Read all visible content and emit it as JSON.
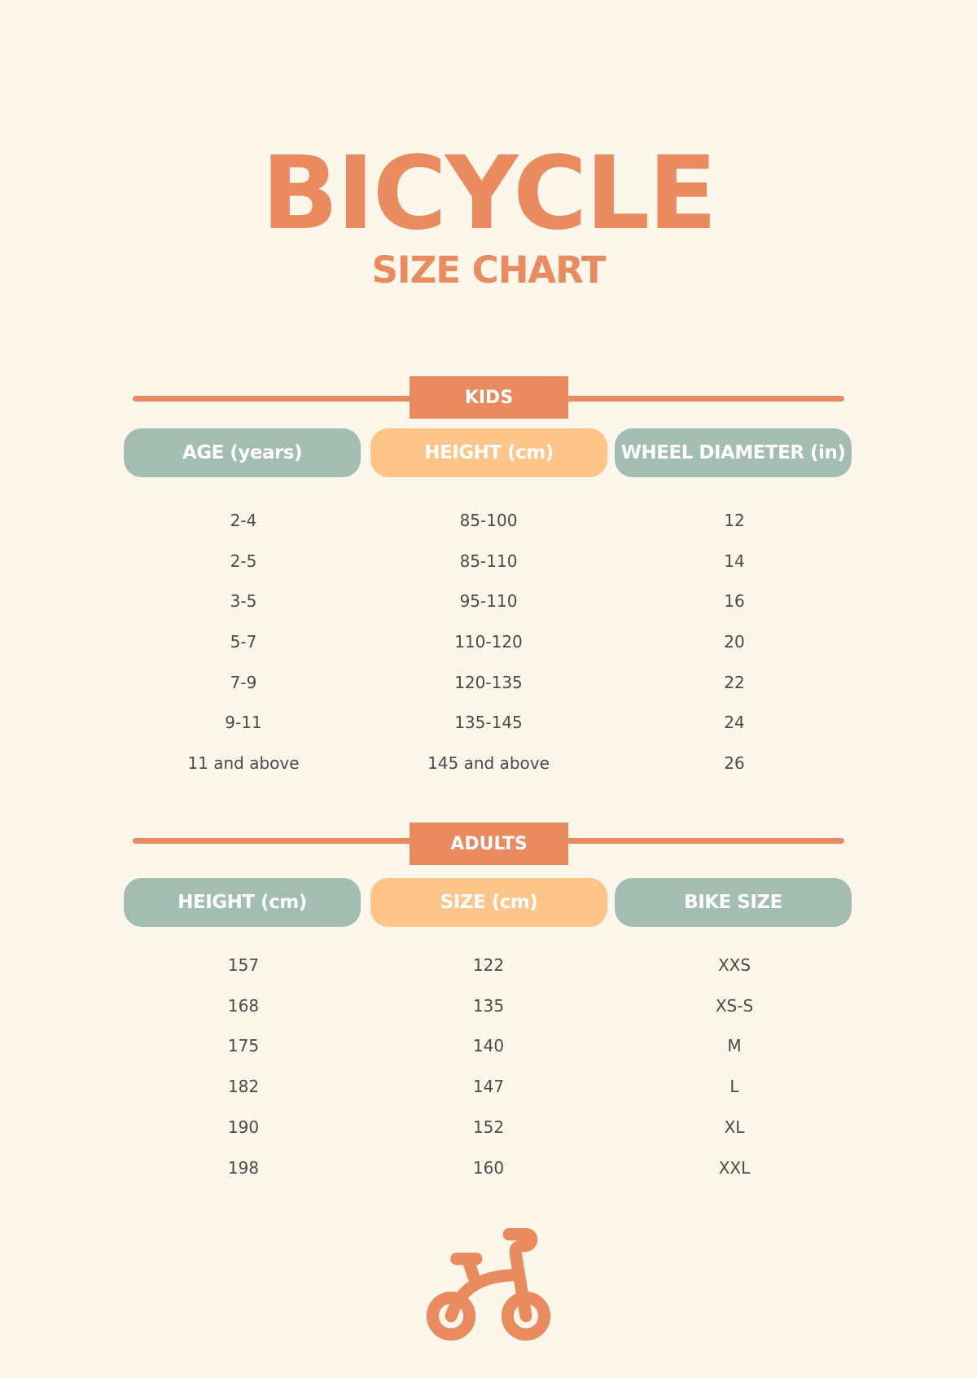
{
  "header": {
    "title": "BICYCLE",
    "subtitle": "SIZE CHART"
  },
  "colors": {
    "accent": "#ea8a5f",
    "background": "#fdf6ea",
    "sage": "#a3bdb3",
    "peach": "#fdc58a",
    "text": "#4a4a4a"
  },
  "kids": {
    "label": "KIDS",
    "columns": [
      "AGE (years)",
      "HEIGHT (cm)",
      "WHEEL DIAMETER (in)"
    ],
    "rows": [
      [
        "2-4",
        "85-100",
        "12"
      ],
      [
        "2-5",
        "85-110",
        "14"
      ],
      [
        "3-5",
        "95-110",
        "16"
      ],
      [
        "5-7",
        "110-120",
        "20"
      ],
      [
        "7-9",
        "120-135",
        "22"
      ],
      [
        "9-11",
        "135-145",
        "24"
      ],
      [
        "11 and above",
        "145 and above",
        "26"
      ]
    ]
  },
  "adults": {
    "label": "ADULTS",
    "columns": [
      "HEIGHT (cm)",
      "SIZE (cm)",
      "BIKE SIZE"
    ],
    "rows": [
      [
        "157",
        "122",
        "XXS"
      ],
      [
        "168",
        "135",
        "XS-S"
      ],
      [
        "175",
        "140",
        "M"
      ],
      [
        "182",
        "147",
        "L"
      ],
      [
        "190",
        "152",
        "XL"
      ],
      [
        "198",
        "160",
        "XXL"
      ]
    ]
  },
  "footer": {
    "icon": "bicycle-icon"
  }
}
